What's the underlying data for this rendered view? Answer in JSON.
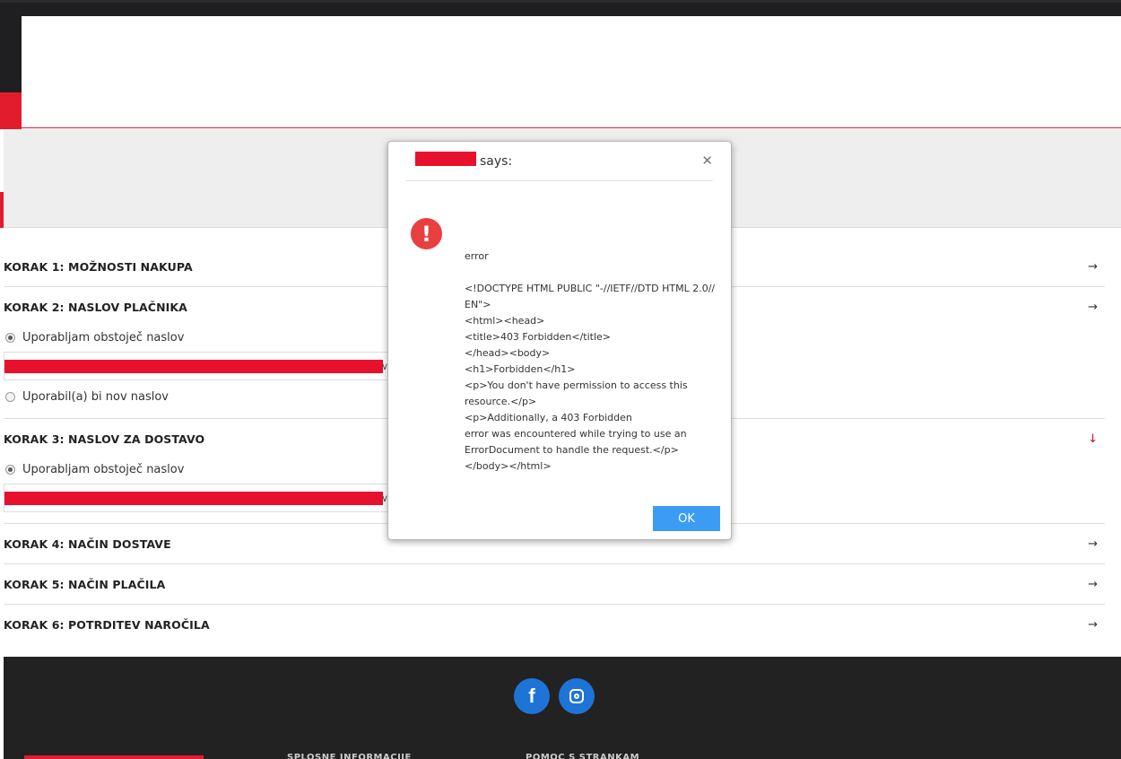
{
  "checkout": {
    "steps": [
      {
        "title": "KORAK 1: MOŽNOSTI NAKUPA"
      },
      {
        "title": "KORAK 2: NASLOV PLAČNIKA",
        "radio_existing": "Uporabljam obstoječ naslov",
        "radio_new": "Uporabil(a) bi nov naslov"
      },
      {
        "title": "KORAK 3: NASLOV ZA DOSTAVO",
        "radio_existing": "Uporabljam obstoječ naslov"
      },
      {
        "title": "KORAK 4: NAČIN DOSTAVE"
      },
      {
        "title": "KORAK 5: NAČIN PLAČILA"
      },
      {
        "title": "KORAK 6: POTRDITEV NAROČILA"
      }
    ],
    "arrow_right": "→",
    "arrow_down": "↓",
    "address_caret": "∨"
  },
  "footer": {
    "facebook_glyph": "f",
    "col1_title": "SPLOŠNE INFORMACIJE",
    "col2_title": "POMOČ S STRANKAM"
  },
  "dialog": {
    "says": "says:",
    "close_glyph": "✕",
    "icon_glyph": "!",
    "message": "error\n\n<!DOCTYPE HTML PUBLIC \"-//IETF//DTD HTML 2.0//\nEN\">\n<html><head>\n<title>403 Forbidden</title>\n</head><body>\n<h1>Forbidden</h1>\n<p>You don't have permission to access this\nresource.</p>\n<p>Additionally, a 403 Forbidden\nerror was encountered while trying to use an\nErrorDocument to handle the request.</p>\n</body></html>",
    "ok_label": "OK"
  },
  "colors": {
    "accent_red": "#e21b2d",
    "ok_blue": "#3c9cf4",
    "social_blue": "#1e74d6",
    "footer_bg": "#222222"
  }
}
